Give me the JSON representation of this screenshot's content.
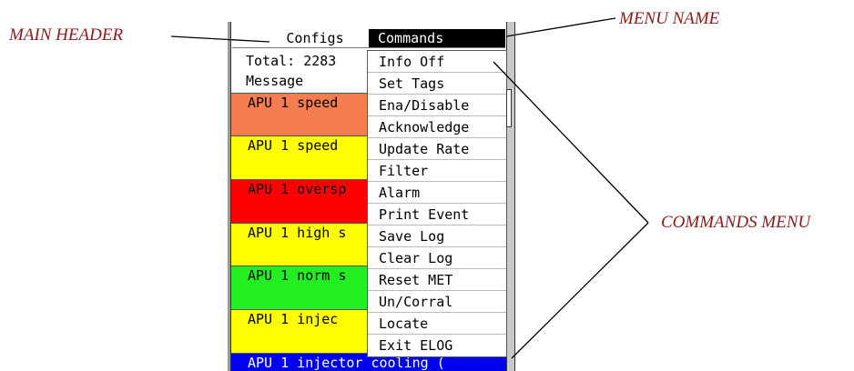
{
  "callouts": {
    "main_header": "MAIN HEADER",
    "menu_name": "MENU NAME",
    "commands_menu": "COMMANDS MENU"
  },
  "window": {
    "header_title": "Configs",
    "total_label": "Total: 2283",
    "message_label": "Message"
  },
  "rows": [
    {
      "text": "APU 1 speed",
      "color": "#f47e50"
    },
    {
      "text": "APU 1 speed",
      "color": "#ffff00"
    },
    {
      "text": "APU 1 oversp",
      "color": "#ff0000"
    },
    {
      "text": "APU 1 high s",
      "color": "#ffff00"
    },
    {
      "text": "APU 1 norm s",
      "color": "#22ee22"
    },
    {
      "text": "APU 1 injec",
      "color": "#ffff00"
    },
    {
      "text": "APU 1 injector cooling (",
      "color": "#0000ee"
    }
  ],
  "menu": {
    "title": "Commands",
    "items": [
      "Info Off",
      "Set Tags",
      "Ena/Disable",
      "Acknowledge",
      "Update Rate",
      "Filter",
      "Alarm",
      "Print Event",
      "Save Log",
      "Clear Log",
      "Reset MET",
      "Un/Corral",
      "Locate",
      "Exit ELOG"
    ]
  },
  "colors": {
    "callout_text": "#8b1a1a",
    "menu_title_bg": "#000000"
  }
}
